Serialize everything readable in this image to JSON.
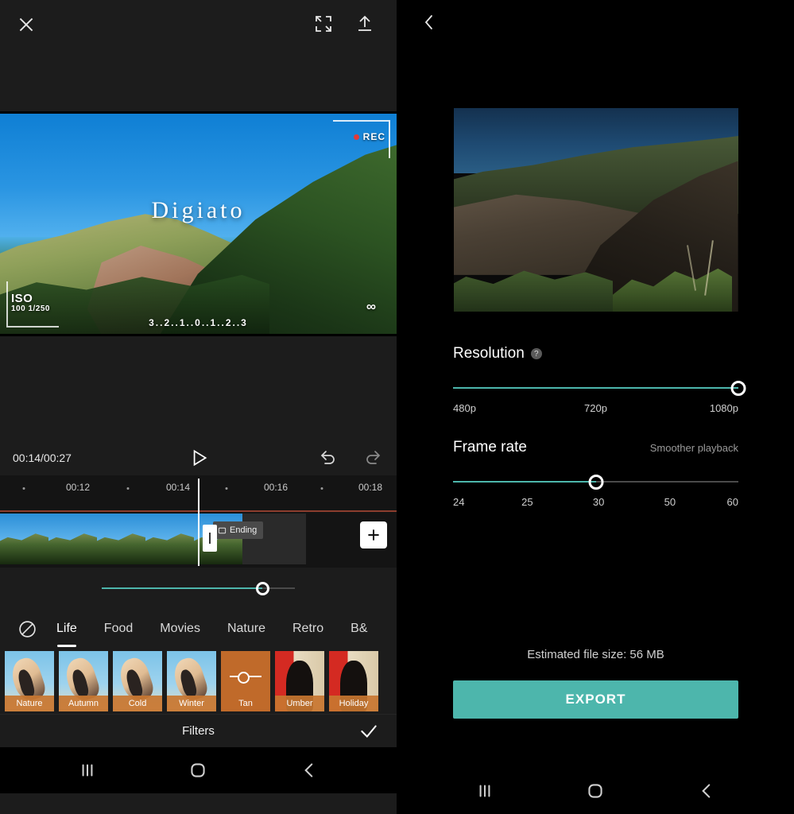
{
  "app": {
    "accent_color": "#4db6ac",
    "panel_bg": "#1c1c1c"
  },
  "left_panel": {
    "topbar": {
      "close_icon": "close-icon",
      "fullscreen_icon": "expand-icon",
      "export_icon": "upload-icon"
    },
    "preview": {
      "watermark_text": "Digiato",
      "rec_label": "REC",
      "iso_label": "ISO",
      "iso_value": "100 1/250",
      "exposure_scale": "3..2..1..0..1..2..3",
      "infinity_symbol": "∞"
    },
    "player": {
      "timecode": "00:14/00:27",
      "play_icon": "play-icon",
      "undo_icon": "undo-icon",
      "redo_icon": "redo-icon"
    },
    "ruler": {
      "labels": [
        "00:12",
        "00:14",
        "00:16",
        "00:18"
      ]
    },
    "timeline": {
      "clip_chip_label": "Ending",
      "add_button_label": "+",
      "thumbnail_count": 5
    },
    "intensity_slider": {
      "value_percent": 83
    },
    "filter_tabs": {
      "none_icon": "no-filter-icon",
      "items": [
        {
          "label": "Life",
          "active": true
        },
        {
          "label": "Food",
          "active": false
        },
        {
          "label": "Movies",
          "active": false
        },
        {
          "label": "Nature",
          "active": false
        },
        {
          "label": "Retro",
          "active": false
        },
        {
          "label": "B&",
          "active": false
        }
      ]
    },
    "presets": [
      {
        "label": "Nature",
        "style": "person",
        "selected": false
      },
      {
        "label": "Autumn",
        "style": "person",
        "selected": false
      },
      {
        "label": "Cold",
        "style": "person",
        "selected": false
      },
      {
        "label": "Winter",
        "style": "person",
        "selected": false
      },
      {
        "label": "Tan",
        "style": "tan",
        "selected": true
      },
      {
        "label": "Umber",
        "style": "umber",
        "selected": false
      },
      {
        "label": "Holiday",
        "style": "umber",
        "selected": false
      }
    ],
    "footer": {
      "title": "Filters",
      "confirm_icon": "check-icon"
    }
  },
  "right_panel": {
    "topbar": {
      "back_icon": "back-chevron-icon"
    },
    "resolution": {
      "label": "Resolution",
      "help_icon": "?",
      "ticks": [
        "480p",
        "720p",
        "1080p"
      ],
      "selected": "1080p",
      "fill_percent": 100
    },
    "frame_rate": {
      "label": "Frame rate",
      "hint": "Smoother playback",
      "ticks": [
        "24",
        "25",
        "30",
        "50",
        "60"
      ],
      "selected": "30",
      "fill_percent": 50
    },
    "file_size_text": "Estimated file size: 56 MB",
    "export_label": "EXPORT"
  },
  "navbar": {
    "recents_icon": "recents-icon",
    "home_icon": "home-icon",
    "back_icon": "back-icon"
  }
}
